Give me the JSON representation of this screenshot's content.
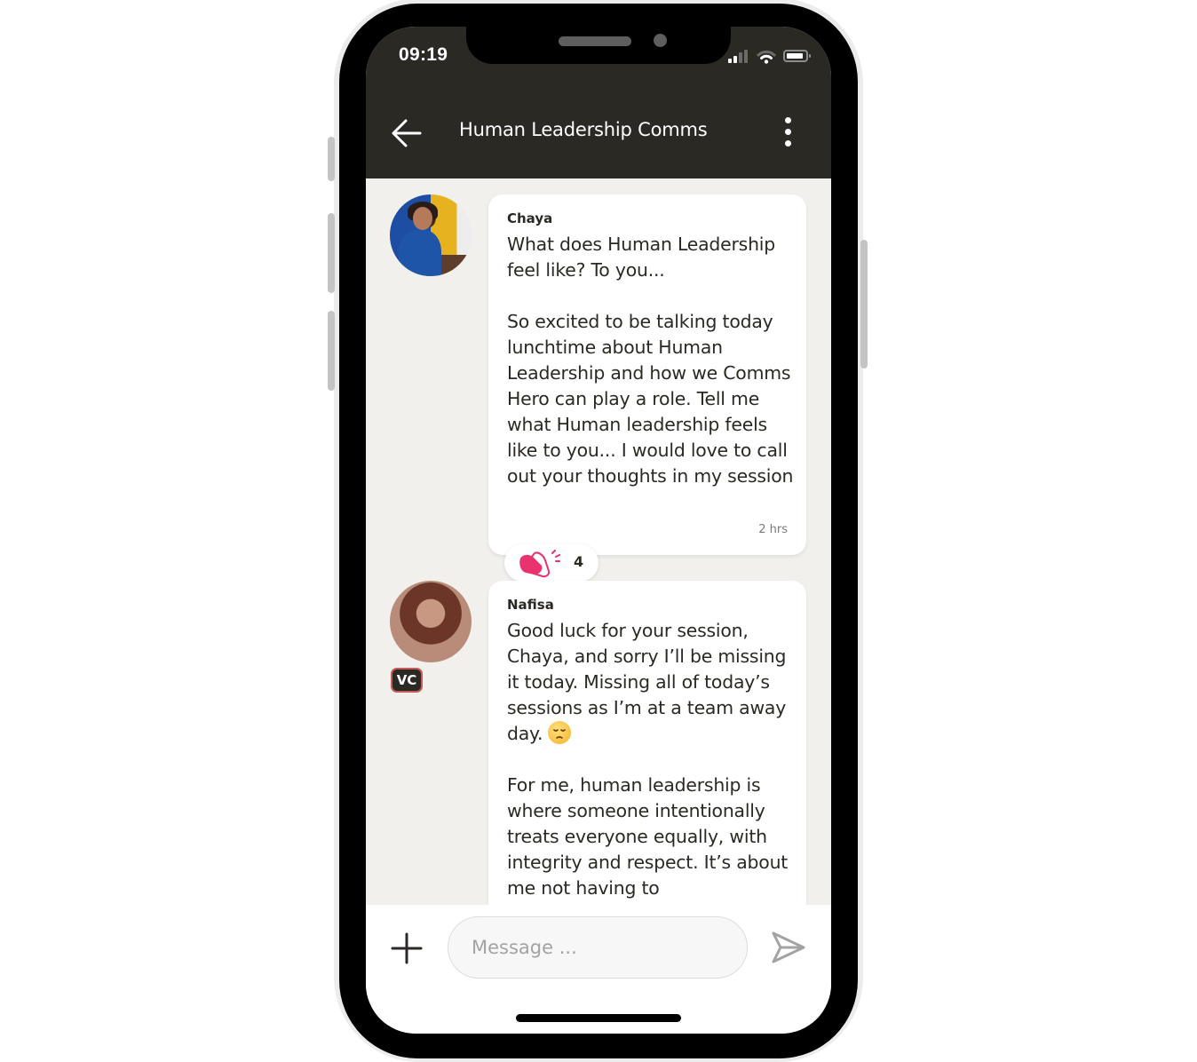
{
  "status_bar": {
    "time": "09:19",
    "icons": [
      "signal-icon",
      "wifi-icon",
      "battery-icon"
    ]
  },
  "header": {
    "back_icon": "arrow-left-icon",
    "title": "Human Leadership Comms",
    "more_icon": "more-vertical-icon"
  },
  "messages": [
    {
      "author": "Chaya",
      "avatar": "photo-avatar",
      "text": "What does Human Leadership feel like? To you...\n\nSo excited to be talking today lunchtime about Human Leadership and how we Comms Hero can play a role. Tell me what Human leadership feels like to you... I would love to call out your thoughts in my session",
      "timestamp": "2 hrs",
      "reaction": {
        "icon": "clapping-hands-icon",
        "count": "4"
      }
    },
    {
      "author": "Nafisa",
      "avatar": "photo-avatar",
      "badge": "VC",
      "text_part1": "Good luck for your session, Chaya, and sorry I’ll be missing it today. Missing all of today’s sessions as I’m at a team away day.",
      "emoji": "pensive-face-emoji",
      "text_part2": "For me, human leadership is where someone intentionally treats everyone equally, with integrity and respect. It’s about me not having to"
    }
  ],
  "composer": {
    "add_icon": "plus-icon",
    "placeholder": "Message ...",
    "value": "",
    "send_icon": "send-icon"
  },
  "colors": {
    "header_bg": "#2b2924",
    "feed_bg": "#f1f0ec",
    "reaction_accent": "#e8336f",
    "text": "#2b2924"
  }
}
